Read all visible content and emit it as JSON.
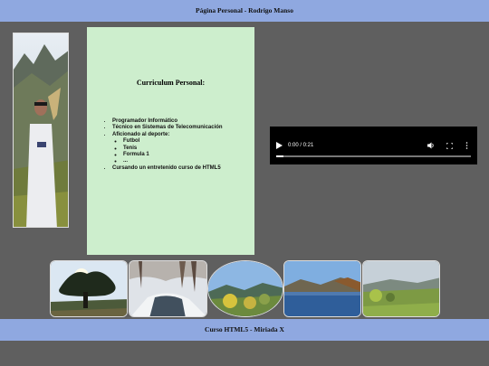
{
  "header": {
    "title": "Página Personal - Rodrigo Manso"
  },
  "cv": {
    "title": "Curriculum Personal:",
    "items": [
      "Programador Informático",
      "Técnico en Sistemas de Telecomunicación",
      "Aficionado al deporte:",
      "Cursando un entretenido curso de HTML5"
    ],
    "sports": [
      "Futbol",
      "Tenis",
      "Formula 1",
      "..."
    ]
  },
  "video": {
    "time": "0:00 / 0:21",
    "progress": 0.0
  },
  "footer": {
    "text": "Curso HTML5 - Miriada X"
  },
  "icons": [
    "play-icon",
    "volume-icon",
    "fullscreen-icon",
    "more-options-icon"
  ]
}
